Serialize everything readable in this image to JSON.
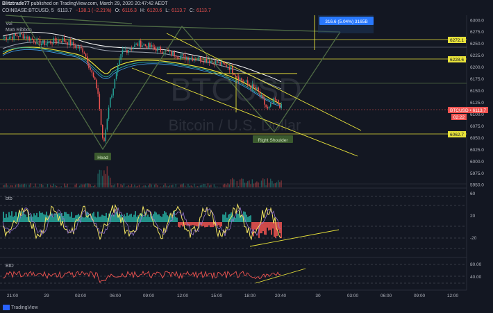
{
  "header": {
    "publisher": "Blitztrade77",
    "published": "published on TradingView.com, March 29, 2020 20:47:42 AEDT",
    "symbol": "COINBASE:BTCUSD, 5",
    "price": "6113.7",
    "change": "−138.1 (−2.21%)",
    "ohlc": {
      "o_label": "O:",
      "o": "6116.3",
      "h_label": "H:",
      "h": "6120.6",
      "l_label": "L:",
      "l": "6113.7",
      "c_label": "C:",
      "c": "6113.7"
    }
  },
  "legend": {
    "vol": "Vol",
    "ma": "Ma5 Ribbon"
  },
  "watermark": {
    "symbol": "BTCUSD",
    "name": "Bitcoin / U.S. Dollar"
  },
  "annotations": {
    "head": "Head",
    "right_shoulder": "Right Shoulder",
    "measure": "316.6 (5.04%) 3165B"
  },
  "price_axis": {
    "ticks": [
      "6300.0",
      "6275.0",
      "6250.0",
      "6225.0",
      "6200.0",
      "6175.0",
      "6150.0",
      "6125.0",
      "6100.0",
      "6075.0",
      "6050.0",
      "6025.0",
      "6000.0",
      "5975.0",
      "5950.0"
    ],
    "markers": [
      {
        "label": "6272.1",
        "color": "#e8e23a"
      },
      {
        "label": "6228.6",
        "color": "#e8e23a"
      },
      {
        "label": "BTCUSD • 6113.7",
        "color": "#ef5350"
      },
      {
        "label": "02:22",
        "color": "#ef5350"
      },
      {
        "label": "6062.7",
        "color": "#e8e23a"
      }
    ]
  },
  "btb": {
    "label": "btb",
    "ticks": [
      "60",
      "20",
      "-20"
    ]
  },
  "bid": {
    "label": "BID",
    "ticks": [
      "80.00",
      "40.00"
    ]
  },
  "time_axis": [
    "21:00",
    "29",
    "03:00",
    "06:00",
    "09:00",
    "12:00",
    "15:00",
    "18:00",
    "20:40",
    "30",
    "03:00",
    "06:00",
    "09:00",
    "12:00"
  ],
  "footer": {
    "brand": "TradingView"
  },
  "colors": {
    "bg": "#131722",
    "up": "#26a69a",
    "down": "#ef5350",
    "yellow": "#e8e23a",
    "green_line": "#4f6b45",
    "label_bg": "#3b5a2e"
  },
  "chart_data": {
    "type": "candlestick",
    "title": "COINBASE:BTCUSD, 5",
    "ylim": [
      5940,
      6310
    ],
    "x": [
      "21:00",
      "29",
      "03:00",
      "06:00",
      "09:00",
      "12:00",
      "15:00",
      "18:00",
      "20:40"
    ],
    "close": [
      6262,
      6250,
      6262,
      6030,
      6240,
      6228,
      6212,
      6175,
      6113.7
    ],
    "key_levels": [
      6272.1,
      6228.6,
      6062.7
    ],
    "pattern": "head and shoulders"
  }
}
